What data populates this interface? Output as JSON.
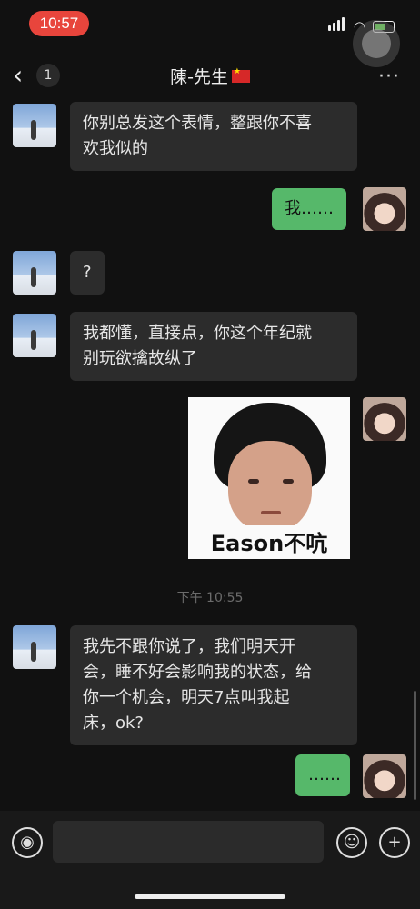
{
  "status_bar": {
    "time": "10:57"
  },
  "nav": {
    "back_count": "1",
    "title": "陳-先生",
    "more": "···"
  },
  "messages": [
    {
      "side": "left",
      "text": "你别总发这个表情，整跟你不喜\n欢我似的"
    },
    {
      "side": "right",
      "text": "我……"
    },
    {
      "side": "left",
      "text": "?"
    },
    {
      "side": "left",
      "text": "我都懂，直接点，你这个年纪就\n别玩欲擒故纵了"
    },
    {
      "side": "right",
      "type": "sticker",
      "caption": "Eason不吭"
    },
    {
      "type": "timestamp",
      "text": "下午 10:55"
    },
    {
      "side": "left",
      "text": "我先不跟你说了，我们明天开\n会，睡不好会影响我的状态，给\n你一个机会，明天7点叫我起\n床，ok?"
    },
    {
      "side": "right",
      "text": "……"
    }
  ],
  "input_bar": {
    "voice_icon": "voice-icon",
    "emoji_icon": "emoji-icon",
    "plus_icon": "plus-icon"
  },
  "colors": {
    "background": "#111111",
    "bubble_left": "#2c2c2c",
    "bubble_right": "#56b86a",
    "time_pill": "#e8453c"
  }
}
